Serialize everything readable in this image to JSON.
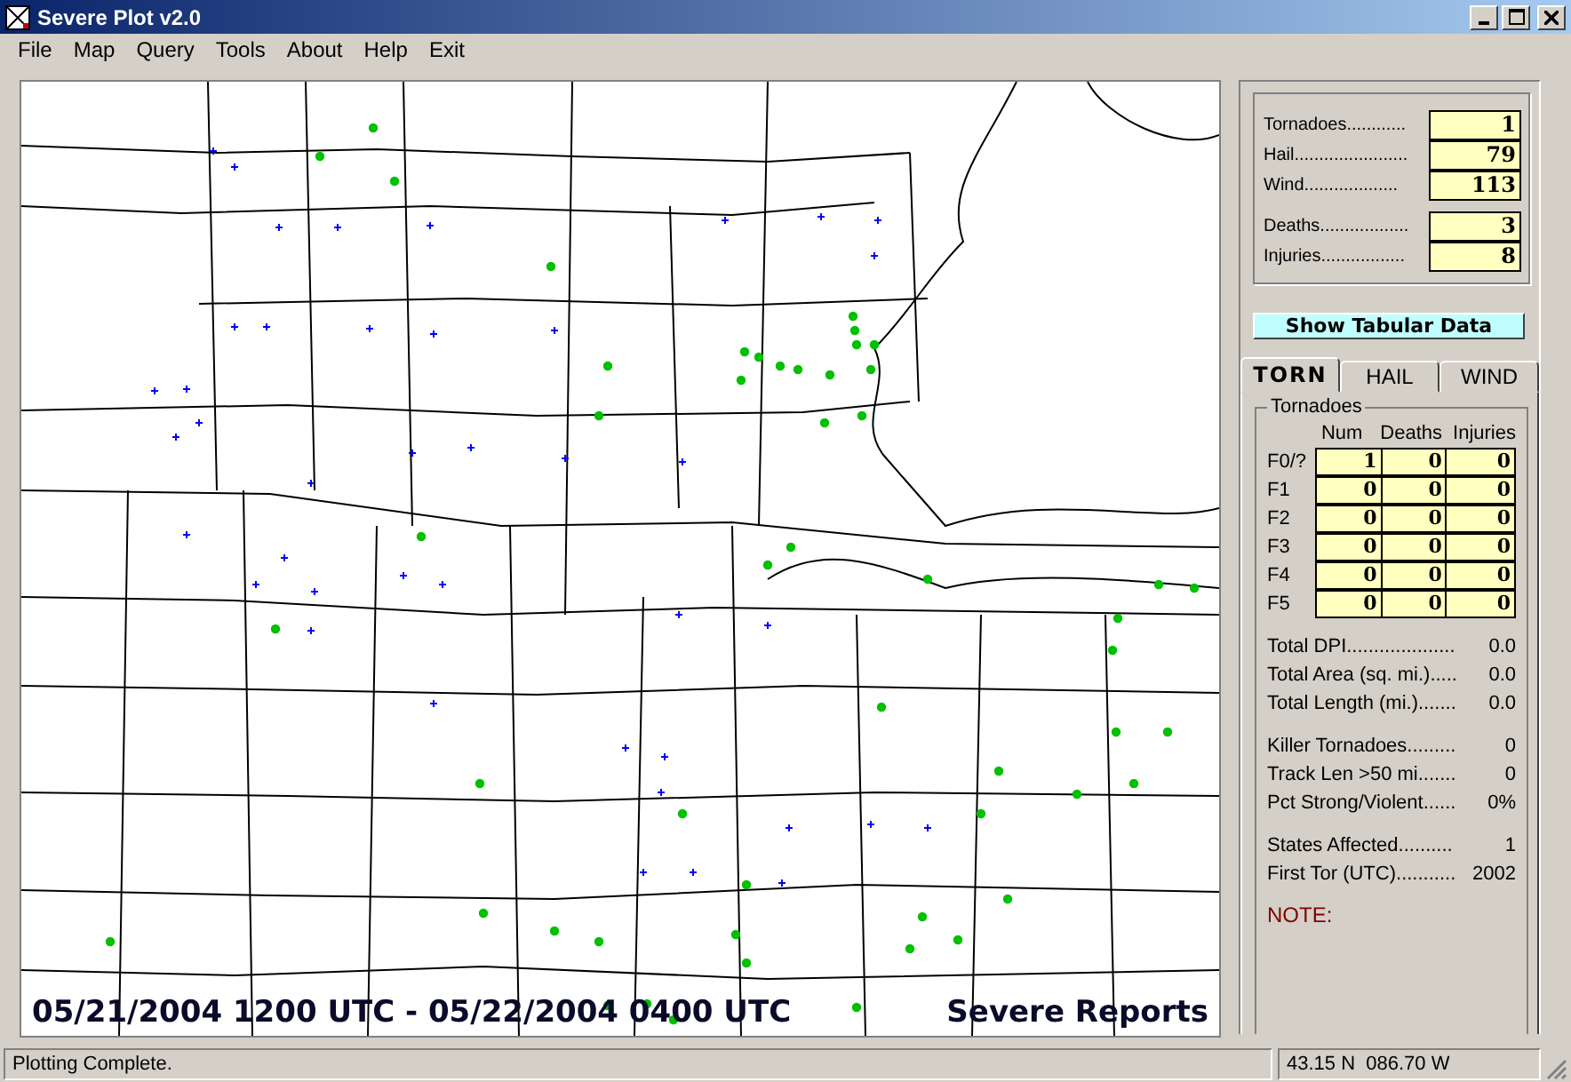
{
  "window": {
    "title": "Severe Plot v2.0"
  },
  "menu": [
    "File",
    "Map",
    "Query",
    "Tools",
    "About",
    "Help",
    "Exit"
  ],
  "map": {
    "date_range": "05/21/2004 1200 UTC - 05/22/2004 0400 UTC",
    "label": "Severe Reports"
  },
  "summary": {
    "counts": [
      {
        "label": "Tornadoes............",
        "value": "1"
      },
      {
        "label": "Hail.......................",
        "value": "79"
      },
      {
        "label": "Wind...................",
        "value": "113"
      }
    ],
    "casualties": [
      {
        "label": "Deaths..................",
        "value": "3"
      },
      {
        "label": "Injuries.................",
        "value": "8"
      }
    ]
  },
  "tabular_button": "Show Tabular Data",
  "tabs": [
    {
      "label": "TORN",
      "selected": true
    },
    {
      "label": "HAIL",
      "selected": false
    },
    {
      "label": "WIND",
      "selected": false
    }
  ],
  "tornadoes": {
    "title": "Tornadoes",
    "columns": [
      "Num",
      "Deaths",
      "Injuries"
    ],
    "rows": [
      {
        "label": "F0/?",
        "values": [
          "1",
          "0",
          "0"
        ]
      },
      {
        "label": "F1",
        "values": [
          "0",
          "0",
          "0"
        ]
      },
      {
        "label": "F2",
        "values": [
          "0",
          "0",
          "0"
        ]
      },
      {
        "label": "F3",
        "values": [
          "0",
          "0",
          "0"
        ]
      },
      {
        "label": "F4",
        "values": [
          "0",
          "0",
          "0"
        ]
      },
      {
        "label": "F5",
        "values": [
          "0",
          "0",
          "0"
        ]
      }
    ]
  },
  "stats": [
    [
      {
        "label": "Total DPI....................",
        "value": "0.0"
      },
      {
        "label": "Total Area (sq. mi.).....",
        "value": "0.0"
      },
      {
        "label": "Total Length (mi.).......",
        "value": "0.0"
      }
    ],
    [
      {
        "label": "Killer Tornadoes.........",
        "value": "0"
      },
      {
        "label": "Track Len >50 mi.......",
        "value": "0"
      },
      {
        "label": "Pct Strong/Violent......",
        "value": "0%"
      }
    ],
    [
      {
        "label": "States Affected..........",
        "value": "1"
      },
      {
        "label": "First Tor (UTC)...........",
        "value": "2002"
      }
    ]
  ],
  "note": "NOTE:",
  "status_bar": {
    "message": "Plotting Complete.",
    "coords": "43.15 N  086.70 W"
  }
}
